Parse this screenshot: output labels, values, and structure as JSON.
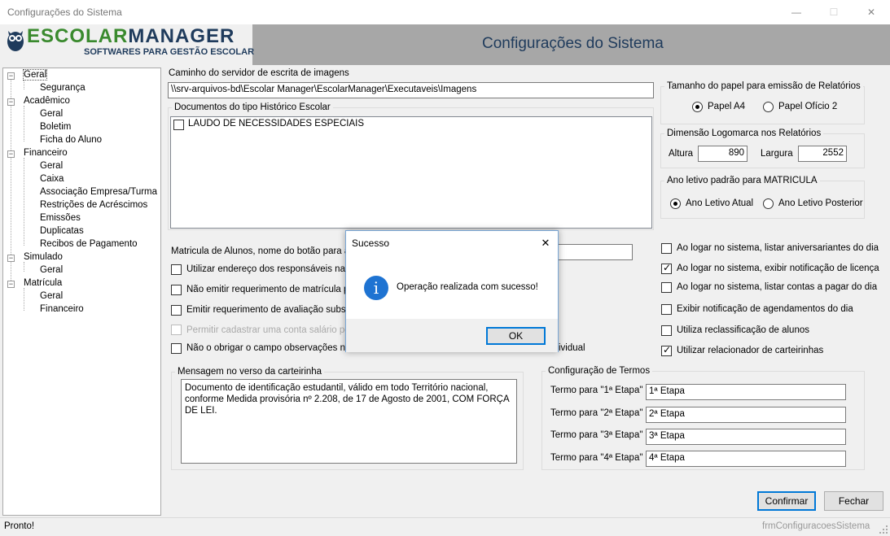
{
  "window": {
    "title": "Configurações do Sistema",
    "minimize": "—",
    "maximize": "☐",
    "close": "✕"
  },
  "header": {
    "logo_text_a": "ESCOLAR",
    "logo_text_b": "MANAGER",
    "logo_tagline": "SOFTWARES PARA GESTÃO ESCOLAR",
    "title": "Configurações do Sistema"
  },
  "tree": {
    "geral": "Geral",
    "seguranca": "Segurança",
    "academico": "Acadêmico",
    "acad_geral": "Geral",
    "boletim": "Boletim",
    "ficha": "Ficha do Aluno",
    "financeiro": "Financeiro",
    "fin_geral": "Geral",
    "caixa": "Caixa",
    "assoc": "Associação Empresa/Turma",
    "restricoes": "Restrições de Acréscimos",
    "emissoes": "Emissões",
    "duplicatas": "Duplicatas",
    "recibos": "Recibos de Pagamento",
    "simulado": "Simulado",
    "sim_geral": "Geral",
    "matricula": "Matrícula",
    "mat_geral": "Geral",
    "mat_fin": "Financeiro"
  },
  "main": {
    "caminho_label": "Caminho do servidor de escrita de imagens",
    "caminho_value": "\\\\srv-arquivos-bd\\Escolar Manager\\EscolarManager\\Executaveis\\Imagens",
    "docs_legend": "Documentos do tipo Histórico Escolar",
    "doc_item": "LAUDO DE NECESSIDADES ESPECIAIS",
    "matricula_label": "Matricula de Alunos, nome do botão para ace",
    "opt1": "Utilizar endereço dos responsáveis nas in",
    "opt2": "Não emitir requerimento de matrícula para",
    "opt3": "Emitir requerimento de avaliação substitut",
    "opt4": "Permitir cadastrar uma conta salário por e",
    "opt5": "Não o obrigar o campo observações no c",
    "opt5_tail": "ividual",
    "msg_legend": "Mensagem no verso da carteirinha",
    "msg_text": "Documento de identificação estudantil, válido em todo Território nacional, conforme Medida provisória nº 2.208, de 17 de Agosto de 2001, COM FORÇA DE LEI."
  },
  "right": {
    "papel_legend": "Tamanho do papel para emissão de Relatórios",
    "papel_a4": "Papel A4",
    "papel_oficio": "Papel Ofício 2",
    "logo_legend": "Dimensão Logomarca nos Relatórios",
    "altura_label": "Altura",
    "altura_value": "890",
    "largura_label": "Largura",
    "largura_value": "2552",
    "ano_legend": "Ano letivo padrão para MATRICULA",
    "ano_atual": "Ano Letivo Atual",
    "ano_post": "Ano Letivo Posterior",
    "chk1": "Ao logar no sistema, listar aniversariantes do dia",
    "chk2": "Ao logar no sistema, exibir notificação de licença",
    "chk3": "Ao logar no sistema, listar contas a pagar do dia",
    "chk4": "Exibir notificação de agendamentos do dia",
    "chk5": "Utiliza reclassificação de alunos",
    "chk6": "Utilizar relacionador de carteirinhas",
    "termos_legend": "Configuração de Termos",
    "t1_label": "Termo para \"1ª Etapa\"",
    "t1_value": "1ª Etapa",
    "t2_label": "Termo para \"2ª Etapa\"",
    "t2_value": "2ª Etapa",
    "t3_label": "Termo para \"3ª Etapa\"",
    "t3_value": "3ª Etapa",
    "t4_label": "Termo para \"4ª Etapa\"",
    "t4_value": "4ª Etapa"
  },
  "buttons": {
    "confirmar": "Confirmar",
    "fechar": "Fechar"
  },
  "dialog": {
    "title": "Sucesso",
    "close": "✕",
    "icon": "i",
    "message": "Operação realizada com sucesso!",
    "ok": "OK"
  },
  "status": {
    "text": "Pronto!",
    "form_name": "frmConfiguracoesSistema"
  },
  "colors": {
    "header_bg": "#a7a7a7",
    "logo_green": "#3a8a2e",
    "logo_navy": "#1f3b5c",
    "info_blue": "#1e73d2",
    "accent_blue": "#0078d7"
  }
}
